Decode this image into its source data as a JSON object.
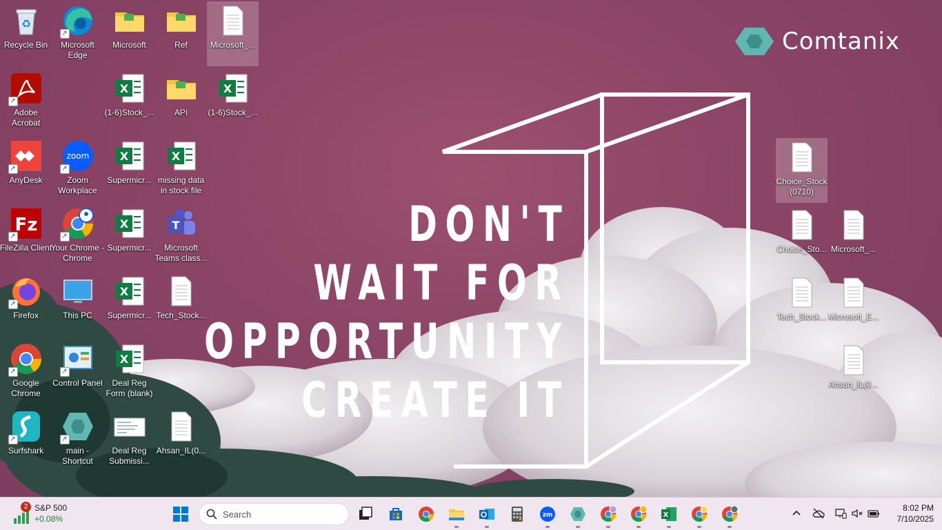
{
  "desktop": {
    "quote": {
      "line1": "DON'T",
      "line2": "WAIT FOR",
      "line3": "OPPORTUNITY",
      "line4": "CREATE IT"
    },
    "brand": {
      "name": "Comtanix",
      "color": "#5fb8b4"
    },
    "icons": [
      {
        "label": "Recycle Bin",
        "icon": "recycle-bin-icon"
      },
      {
        "label": "Microsoft Edge",
        "icon": "edge-icon"
      },
      {
        "label": "Microsoft",
        "icon": "folder-icon"
      },
      {
        "label": "Ref",
        "icon": "folder-icon"
      },
      {
        "label": "Microsoft_...",
        "icon": "document-icon"
      },
      {
        "label": "Adobe Acrobat",
        "icon": "acrobat-icon"
      },
      {
        "label": "(1-6)Stock_...",
        "icon": "excel-icon"
      },
      {
        "label": "API",
        "icon": "folder-icon"
      },
      {
        "label": "(1-6)Stock_...",
        "icon": "excel-icon"
      },
      {
        "label": "AnyDesk",
        "icon": "anydesk-icon"
      },
      {
        "label": "Zoom Workplace",
        "icon": "zoom-icon"
      },
      {
        "label": "Supermicr...",
        "icon": "excel-icon"
      },
      {
        "label": "missing data in stock file",
        "icon": "excel-icon"
      },
      {
        "label": "FileZilla Client",
        "icon": "filezilla-icon"
      },
      {
        "label": "Your Chrome - Chrome",
        "icon": "chrome-profile-icon"
      },
      {
        "label": "Supermicr...",
        "icon": "excel-icon"
      },
      {
        "label": "Microsoft Teams class...",
        "icon": "teams-icon"
      },
      {
        "label": "Firefox",
        "icon": "firefox-icon"
      },
      {
        "label": "This PC",
        "icon": "monitor-icon"
      },
      {
        "label": "Supermicr...",
        "icon": "excel-icon"
      },
      {
        "label": "Tech_Stock...",
        "icon": "document-icon"
      },
      {
        "label": "Google Chrome",
        "icon": "chrome-icon"
      },
      {
        "label": "Control Panel",
        "icon": "control-panel-icon"
      },
      {
        "label": "Deal Reg Form (blank)",
        "icon": "excel-icon"
      },
      {
        "label": "Surfshark",
        "icon": "surfshark-icon"
      },
      {
        "label": "main - Shortcut",
        "icon": "comtanix-icon"
      },
      {
        "label": "Deal Reg Submissi...",
        "icon": "image-file-icon"
      },
      {
        "label": "Ahsan_IL(0...",
        "icon": "document-icon"
      },
      {
        "label": "Choice_Stock (0710)",
        "icon": "document-icon"
      },
      {
        "label": "Choice_Sto...",
        "icon": "document-icon"
      },
      {
        "label": "Microsoft_...",
        "icon": "document-icon"
      },
      {
        "label": "Tech_Stock...",
        "icon": "document-icon"
      },
      {
        "label": "Microsoft_E...",
        "icon": "document-icon"
      },
      {
        "label": "Ahsan_IL(0...",
        "icon": "document-icon"
      }
    ]
  },
  "taskbar": {
    "widget": {
      "title": "S&P 500",
      "change": "+0.08%",
      "badge": "2"
    },
    "search": {
      "placeholder": "Search"
    },
    "clock": {
      "time": "8:02 PM",
      "date": "7/10/2025"
    }
  }
}
